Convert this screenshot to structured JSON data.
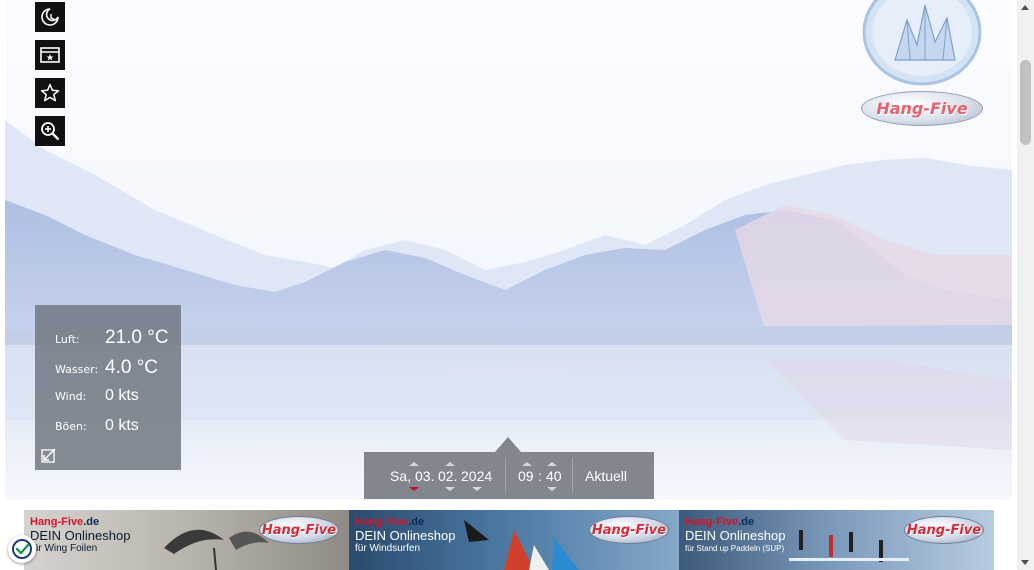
{
  "toolbar": {
    "night_icon": "moon-clock-icon",
    "window_icon": "picture-window-icon",
    "favorite_icon": "star-icon",
    "zoom_icon": "zoom-in-icon"
  },
  "weather": {
    "air_label": "Luft:",
    "air_value": "21.0 °C",
    "water_label": "Wasser:",
    "water_value": "4.0 °C",
    "wind_label": "Wind:",
    "wind_value": "0 kts",
    "gusts_label": "Böen:",
    "gusts_value": "0 kts",
    "expand_icon": "resize-arrow-icon"
  },
  "datetime": {
    "weekday": "Sa,",
    "day": "03.",
    "month": "02.",
    "year": "2024",
    "hour": "09",
    "colon": ":",
    "minute": "40",
    "current_button": "Aktuell"
  },
  "logo": {
    "brand": "Hang-Five"
  },
  "banners": [
    {
      "brand_a": "Hang-Five",
      "brand_b": ".de",
      "line1": "DEIN Onlineshop",
      "line2": "für Wing Foilen",
      "logo": "Hang-Five"
    },
    {
      "brand_a": "Hang-Five",
      "brand_b": ".de",
      "line1": "DEIN Onlineshop",
      "line2": "für Windsurfen",
      "logo": "Hang-Five"
    },
    {
      "brand_a": "Hang-Five",
      "brand_b": ".de",
      "line1": "DEIN Onlineshop",
      "line2": "für Stand up Paddeln (SUP)",
      "logo": "Hang-Five"
    }
  ],
  "colors": {
    "panel": "#6e747e",
    "accent_red": "#c0102a",
    "sky": "#f4f6fd",
    "water": "#cdd8ec"
  }
}
